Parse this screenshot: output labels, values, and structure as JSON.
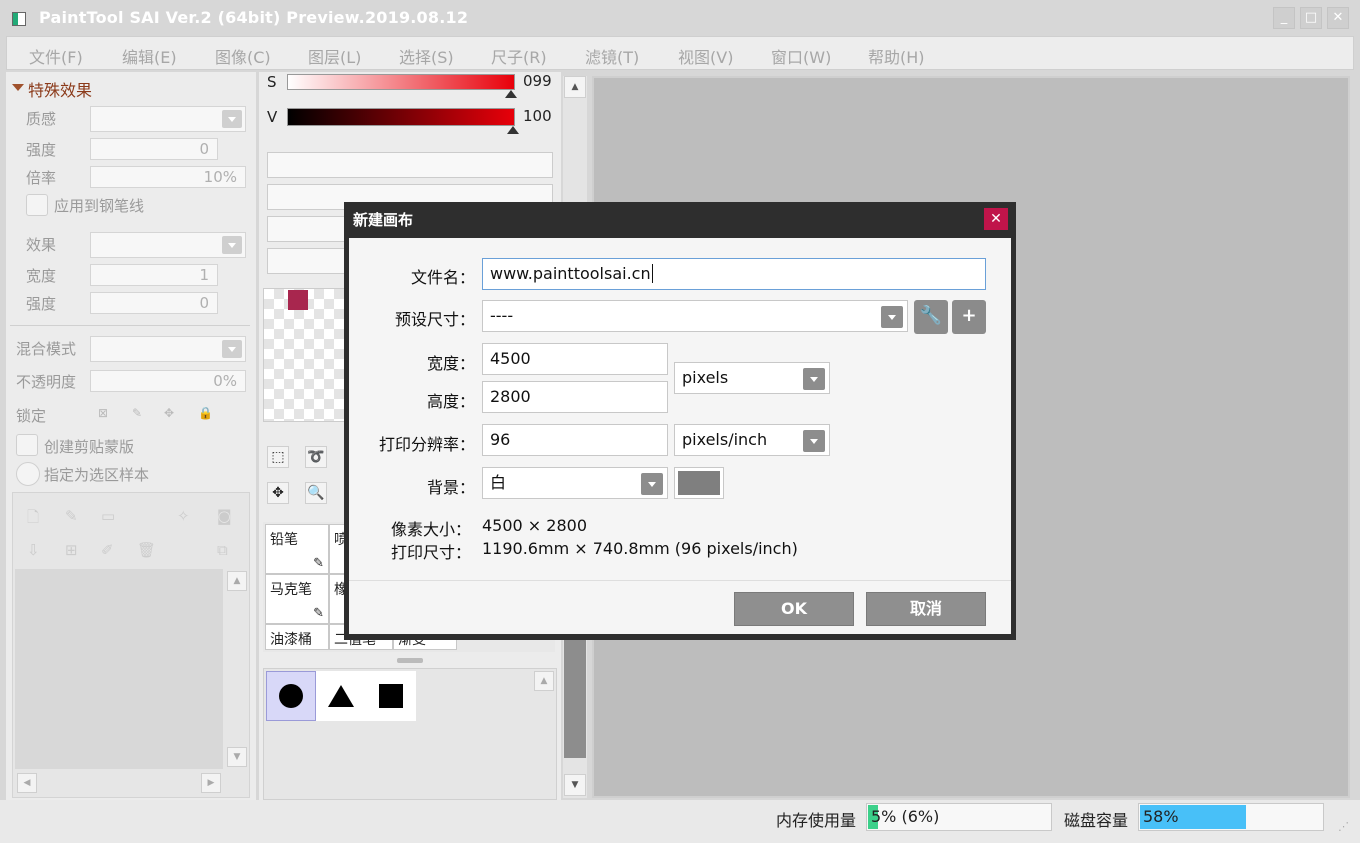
{
  "window": {
    "title": "PaintTool SAI Ver.2 (64bit) Preview.2019.08.12",
    "controls": {
      "minimize": "_",
      "maximize": "□",
      "close": "✕"
    }
  },
  "menu": [
    "文件(F)",
    "编辑(E)",
    "图像(C)",
    "图层(L)",
    "选择(S)",
    "尺子(R)",
    "滤镜(T)",
    "视图(V)",
    "窗口(W)",
    "帮助(H)"
  ],
  "effects_panel": {
    "header": "特殊效果",
    "texture_label": "质感",
    "strength1_label": "强度",
    "strength1_value": "0",
    "scale_label": "倍率",
    "scale_value": "10%",
    "apply_pen_label": "应用到钢笔线",
    "effect_label": "效果",
    "width_label": "宽度",
    "width_value": "1",
    "strength2_label": "强度",
    "strength2_value": "0"
  },
  "layer_panel": {
    "blend_mode_label": "混合模式",
    "opacity_label": "不透明度",
    "opacity_value": "0%",
    "lock_label": "锁定",
    "clip_label": "创建剪贴蒙版",
    "sample_label": "指定为选区样本"
  },
  "color_panel": {
    "s_label": "S",
    "s_value": "099",
    "v_label": "V",
    "v_value": "100"
  },
  "tools": {
    "row1": [
      "铅笔",
      "喷"
    ],
    "row2": [
      "马克笔",
      "橡"
    ],
    "row3": [
      "油漆桶",
      "二值笔",
      "渐变"
    ]
  },
  "dialog": {
    "title": "新建画布",
    "close": "✕",
    "filename_label": "文件名：",
    "filename_value": "www.painttoolsai.cn",
    "preset_label": "预设尺寸：",
    "preset_value": "----",
    "width_label": "宽度：",
    "width_value": "4500",
    "height_label": "高度：",
    "height_value": "2800",
    "unit_value": "pixels",
    "resolution_label": "打印分辨率：",
    "resolution_value": "96",
    "resolution_unit": "pixels/inch",
    "background_label": "背景：",
    "background_value": "白",
    "pixel_size_label": "像素大小：",
    "pixel_size_value": "4500 × 2800",
    "print_size_label": "打印尺寸：",
    "print_size_value": "1190.6mm × 740.8mm (96 pixels/inch)",
    "ok": "OK",
    "cancel": "取消"
  },
  "status": {
    "memory_label": "内存使用量",
    "memory_value": "5% (6%)",
    "memory_fill": 0.05,
    "disk_label": "磁盘容量",
    "disk_value": "58%",
    "disk_fill": 0.58
  },
  "colors": {
    "accent_red": "#e8000a",
    "close_red": "#c0144a",
    "swatch": "#a8264e",
    "disk_bar": "#48c0f8",
    "memory_bar": "#3cd08a"
  }
}
